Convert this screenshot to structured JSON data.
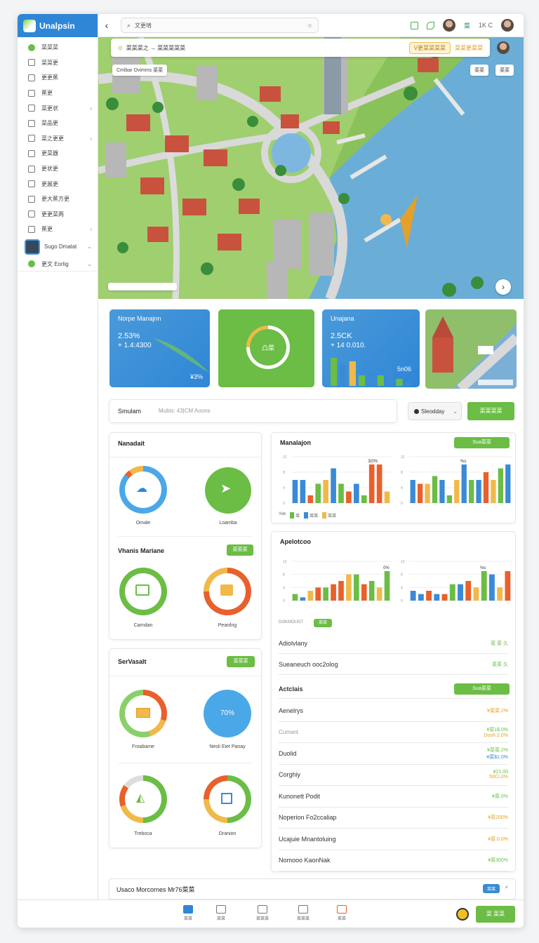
{
  "app": {
    "name": "Unalpsin"
  },
  "sidebar": {
    "items": [
      {
        "label": "菜菜菜",
        "icon": "dot-icon",
        "chev": false
      },
      {
        "label": "菜菜更",
        "icon": "plus-box-icon",
        "chev": false
      },
      {
        "label": "更更蕉",
        "icon": "grid-icon",
        "chev": false
      },
      {
        "label": "蕉更",
        "icon": "building-icon",
        "chev": false
      },
      {
        "label": "菜更状",
        "icon": "gear-icon",
        "chev": true
      },
      {
        "label": "菜品更",
        "icon": "clock-icon",
        "chev": false
      },
      {
        "label": "菜之更更",
        "icon": "grid-icon",
        "chev": true
      },
      {
        "label": "更菜器",
        "icon": "search-icon",
        "chev": false
      },
      {
        "label": "更状更",
        "icon": "list-icon",
        "chev": false
      },
      {
        "label": "更展更",
        "icon": "list-icon",
        "chev": false
      },
      {
        "label": "更大蕉方更",
        "icon": "list-icon",
        "chev": false
      },
      {
        "label": "更更菜两",
        "icon": "list-icon",
        "chev": false
      },
      {
        "label": "蕉更",
        "icon": "circle-icon",
        "chev": true
      }
    ],
    "user": {
      "name": "Sugo Dmalat"
    },
    "last": {
      "label": "更文 Eorlig"
    }
  },
  "topbar": {
    "search": "文更啃",
    "right_text": "菜",
    "counter": "1K C"
  },
  "map": {
    "title": "菜菜菜之 → 菜菜菜菜菜",
    "chip": "V更菜菜菜菜",
    "chip_alt": "菜菜更菜菜",
    "top_left": "Cmlbar Ovimms 菜菜",
    "top_right_a": "菜菜",
    "top_right_b": "菜菜"
  },
  "kpis": {
    "k1": {
      "title": "Norpe Manajnn",
      "v1": "2.53%",
      "v2": "+ 1.4:4300",
      "foot": "¥3%"
    },
    "k2": {
      "ring_label": "凸菜"
    },
    "k3": {
      "title": "Unajana",
      "v1": "2.5CK",
      "v2": "+ 14 0.010.",
      "v3": "5n06"
    }
  },
  "sim": {
    "title": "Smulam",
    "sub": "Mubis: 43|CM  Aoons",
    "select": "Sleodday",
    "action": "菜菜菜菜"
  },
  "left1": {
    "title": "Nanadait",
    "rings": [
      {
        "label": "Omale",
        "icon": "cloud-icon",
        "pct": 86
      },
      {
        "label": "Loamba",
        "icon": "send-icon",
        "pct": 100
      }
    ]
  },
  "left2": {
    "title": "Vhanis Mariane",
    "btn": "菜菜菜",
    "rings": [
      {
        "label": "Carndan",
        "icon": "edit-icon",
        "pct": 100
      },
      {
        "label": "Peardng",
        "icon": "pencil-icon",
        "pct": 75
      }
    ]
  },
  "left3": {
    "title": "SerVasalt",
    "btn": "菜菜菜",
    "rings": [
      {
        "label": "Froabame",
        "icon": "envelope-icon",
        "pct": 70
      },
      {
        "label": "Nesli Eiet Panay",
        "center": "70%",
        "pct": 100
      },
      {
        "label": "Treboca",
        "icon": "map-icon",
        "pct": 80
      },
      {
        "label": "Oranion",
        "icon": "chart-icon",
        "pct": 70
      }
    ]
  },
  "right1": {
    "title": "Manalajon",
    "btn": "Sua菜菜",
    "legend": [
      "Yeb",
      "菜",
      "菜菜",
      "菜菜"
    ],
    "left_peak_label": "3(0%",
    "right_peak_label": "%s"
  },
  "right2": {
    "title": "Apelotcoo",
    "left_peak_label": "0%",
    "right_peak_label": "%s",
    "footer_chip": "菜菜",
    "footer_label": "DOKMOUNT"
  },
  "right_rows": [
    {
      "label": "Adiolvlany",
      "val": "菜 菜 久",
      "cls": "",
      "muted": false
    },
    {
      "label": "Sueaneuch ooc2olog",
      "val": "菜菜 久",
      "cls": "",
      "muted": false
    }
  ],
  "actions": {
    "title": "Actclais",
    "btn": "Sua菜菜"
  },
  "detail_rows": [
    {
      "label": "Aenelrys",
      "val": "¥菜菜.2%",
      "val2": "",
      "cls": "y",
      "muted": false
    },
    {
      "label": "Cumant",
      "val": "¥菜1$.0%",
      "val2": "Dooh.2.0%",
      "cls": "",
      "muted": true
    },
    {
      "label": "Duolid",
      "val": "¥菜菜.2%",
      "val2": "¥菜$1.0%",
      "cls": "",
      "muted": false
    },
    {
      "label": "Corghiy",
      "val": "¥21.00",
      "val2": "50CI.0%",
      "cls": "",
      "muted": false
    },
    {
      "label": "Kunonett Podit",
      "val": "¥菜.0%",
      "val2": "",
      "cls": "",
      "muted": false
    },
    {
      "label": "Noperion Fo2ccaliap",
      "val": "¥菜200%",
      "val2": "",
      "cls": "y",
      "muted": false
    },
    {
      "label": "Ucajuie Mnantoluing",
      "val": "¥菜.0.0%",
      "val2": "",
      "cls": "y",
      "muted": false
    },
    {
      "label": "Nomooo KaonNak",
      "val": "¥菜300%",
      "val2": "",
      "cls": "",
      "muted": false
    }
  ],
  "bottom_strip": {
    "title": "Usaco Morcornes Mr76菜菜",
    "chip": "菜菜"
  },
  "bottom_nav": [
    {
      "label": "菜菜",
      "icon": "home-icon"
    },
    {
      "label": "菜菜",
      "icon": "book-icon"
    },
    {
      "label": "菜菜菜",
      "icon": "building-icon"
    },
    {
      "label": "菜菜菜",
      "icon": "search-icon"
    },
    {
      "label": "菜菜",
      "icon": "notification-icon"
    }
  ],
  "bottom_btn": "菜 菜菜",
  "chart_data": [
    {
      "type": "bar",
      "name": "manalajon-left",
      "ylim": [
        0,
        12
      ],
      "yticks": [
        "0",
        "4",
        "8",
        "12"
      ],
      "values": [
        6,
        6,
        2,
        5,
        6,
        9,
        5,
        3,
        5,
        2,
        10,
        10,
        3
      ],
      "colors": [
        "#3a8ad6",
        "#3a8ad6",
        "#e8602c",
        "#6bbd45",
        "#f0b94a",
        "#3a8ad6",
        "#6bbd45",
        "#e8602c",
        "#3a8ad6",
        "#6bbd45",
        "#e8602c",
        "#e8602c",
        "#f0b94a"
      ]
    },
    {
      "type": "bar",
      "name": "manalajon-right",
      "ylim": [
        0,
        12
      ],
      "yticks": [
        "0",
        "4",
        "8",
        "12"
      ],
      "values": [
        6,
        5,
        5,
        7,
        6,
        2,
        6,
        10,
        6,
        6,
        8,
        6,
        9,
        10
      ],
      "colors": [
        "#3a8ad6",
        "#e8602c",
        "#f0b94a",
        "#6bbd45",
        "#3a8ad6",
        "#6bbd45",
        "#f0b94a",
        "#3a8ad6",
        "#6bbd45",
        "#3a8ad6",
        "#e8602c",
        "#f0b94a",
        "#6bbd45",
        "#3a8ad6"
      ]
    },
    {
      "type": "bar",
      "name": "apelotcoo-left",
      "ylim": [
        0,
        12
      ],
      "yticks": [
        "0",
        "4",
        "8",
        "12"
      ],
      "values": [
        2,
        1,
        3,
        4,
        4,
        5,
        6,
        8,
        8,
        5,
        6,
        4,
        9
      ],
      "colors": [
        "#6bbd45",
        "#3a8ad6",
        "#f0b94a",
        "#e8602c",
        "#6bbd45",
        "#e8602c",
        "#e8602c",
        "#f0b94a",
        "#6bbd45",
        "#e8602c",
        "#6bbd45",
        "#f0b94a",
        "#6bbd45"
      ]
    },
    {
      "type": "bar",
      "name": "apelotcoo-right",
      "ylim": [
        0,
        12
      ],
      "yticks": [
        "0",
        "4",
        "8",
        "12"
      ],
      "values": [
        3,
        2,
        3,
        2,
        2,
        5,
        5,
        6,
        4,
        9,
        8,
        4,
        9
      ],
      "colors": [
        "#3a8ad6",
        "#3a8ad6",
        "#e8602c",
        "#3a8ad6",
        "#e8602c",
        "#6bbd45",
        "#3a8ad6",
        "#e8602c",
        "#f0b94a",
        "#6bbd45",
        "#3a8ad6",
        "#f0b94a",
        "#e8602c"
      ]
    },
    {
      "type": "bar",
      "name": "kpi-mini",
      "ylim": [
        0,
        10
      ],
      "values": [
        8,
        6,
        7,
        3,
        4,
        3,
        5,
        2,
        1
      ],
      "colors": [
        "#6bbd45",
        "#3a8ad6",
        "#f0b94a",
        "#6bbd45",
        "#3a8ad6",
        "#6bbd45",
        "#3a8ad6",
        "#6bbd45",
        "#3a8ad6"
      ]
    }
  ],
  "colors": {
    "brand": "#2f86d6",
    "accent": "#6bbd45",
    "warning": "#f0b94a",
    "danger": "#e8602c"
  }
}
